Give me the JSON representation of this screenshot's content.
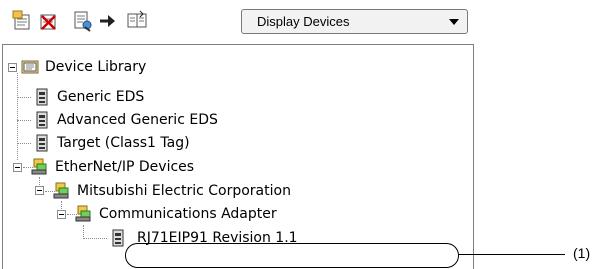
{
  "toolbar": {
    "icons": [
      "add-eds-icon",
      "delete-eds-icon",
      "export-eds-icon",
      "forward-arrow-icon",
      "display-settings-icon"
    ],
    "display_select": {
      "value": "Display Devices"
    }
  },
  "tree": {
    "root": {
      "label": "Device Library",
      "icon": "library-folder-icon"
    },
    "generic_eds": {
      "label": "Generic EDS"
    },
    "advanced_generic_eds": {
      "label": "Advanced Generic EDS"
    },
    "target_class1": {
      "label": "Target (Class1 Tag)"
    },
    "ethernet_ip_devices": {
      "label": "EtherNet/IP Devices"
    },
    "vendor": {
      "label": "Mitsubishi Electric Corporation"
    },
    "comm_adapter": {
      "label": "Communications Adapter"
    },
    "rj71": {
      "label": "RJ71EIP91 Revision 1.1"
    }
  },
  "annotation": {
    "label": "(1)"
  }
}
